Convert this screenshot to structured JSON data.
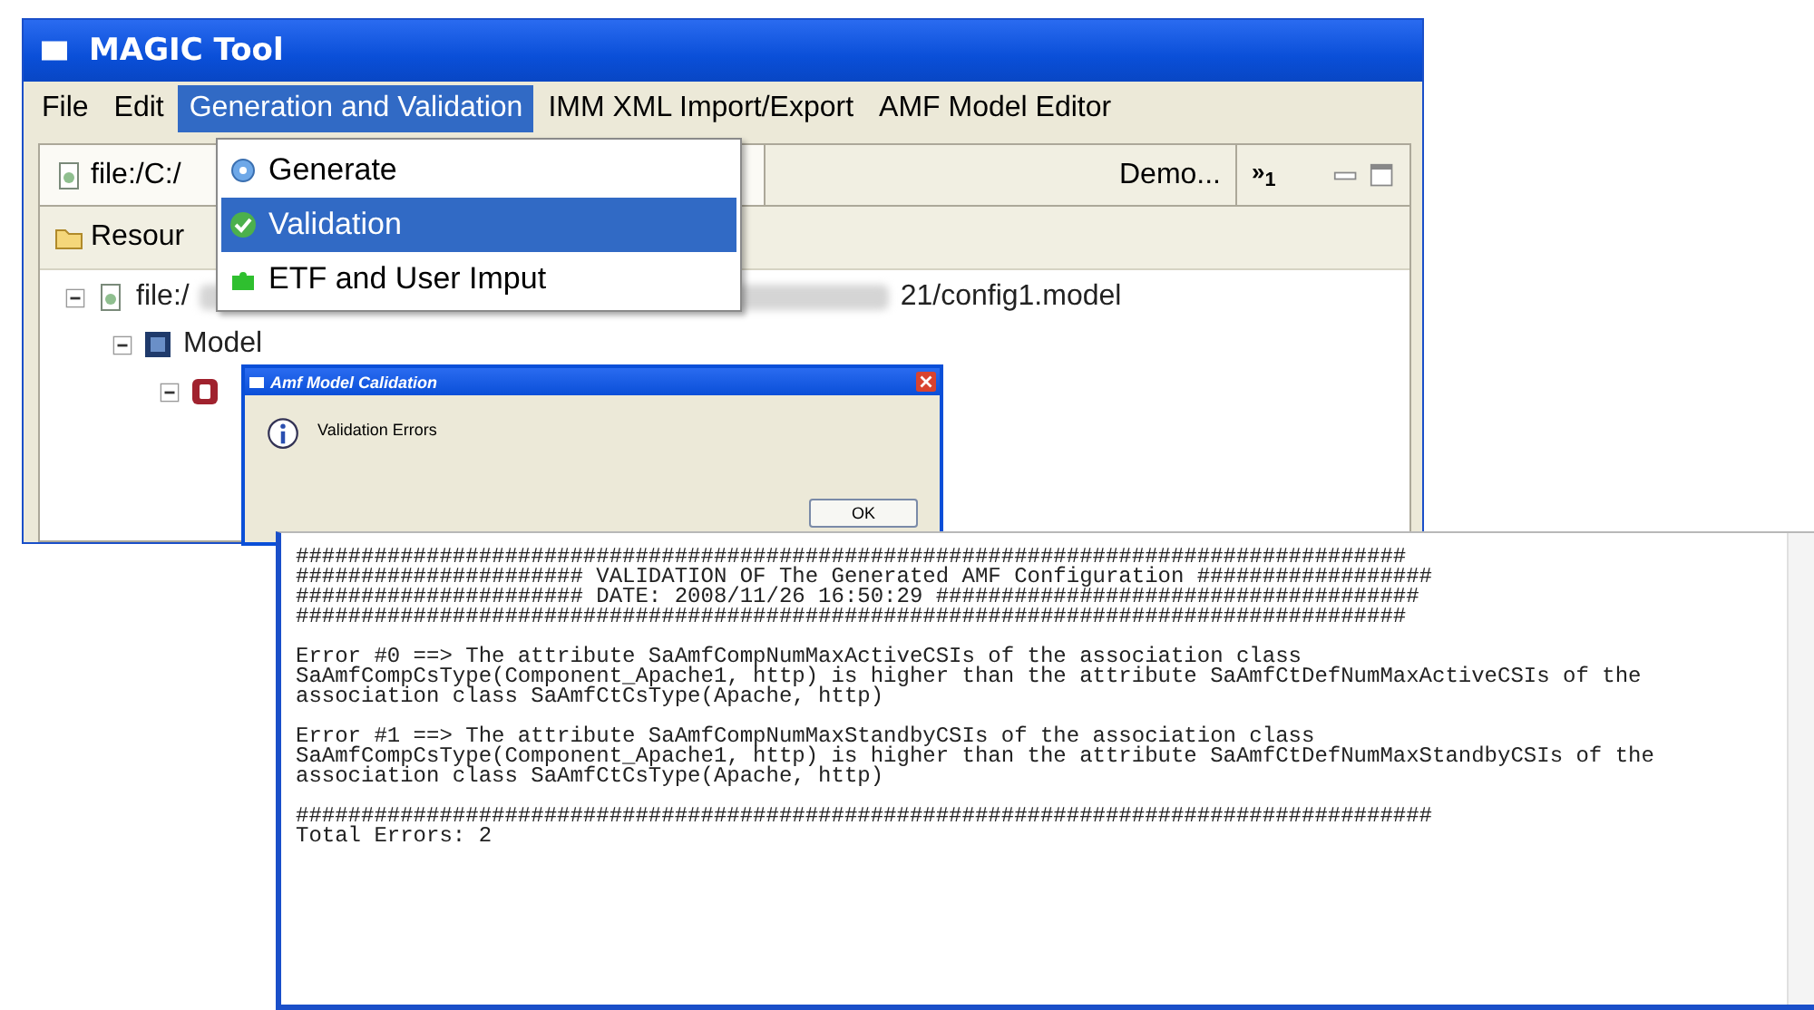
{
  "main_window": {
    "title": "MAGIC Tool"
  },
  "menu_bar": [
    {
      "label": "File",
      "selected": false
    },
    {
      "label": "Edit",
      "selected": false
    },
    {
      "label": "Generation and Validation",
      "selected": true
    },
    {
      "label": "IMM XML Import/Export",
      "selected": false
    },
    {
      "label": "AMF Model Editor",
      "selected": false
    }
  ],
  "dropdown_menu": [
    {
      "label": "Generate",
      "selected": false
    },
    {
      "label": "Validation",
      "selected": true
    },
    {
      "label": "ETF and User Imput",
      "selected": false
    }
  ],
  "editor_tabs": [
    {
      "label": "file:/C:/",
      "selected": true
    },
    {
      "label": "Demo...",
      "selected": false
    }
  ],
  "tab_overflow": "»$_{1}$",
  "resources_tab": {
    "label": "Resour"
  },
  "tree": [
    {
      "label_start": "file:/",
      "label_end": "21/config1.model",
      "expanded": true,
      "children": [
        {
          "label": "Model",
          "expanded": true,
          "children": [
            {
              "expanded": true
            }
          ]
        }
      ]
    }
  ],
  "dialog": {
    "title": "Amf Model Calidation",
    "message": "Validation Errors",
    "button": "OK"
  },
  "console": {
    "blocks": [
      [
        "#####################################################################################",
        "###################### VALIDATION OF The Generated AMF Configuration ##################",
        "###################### DATE: 2008/11/26 16:50:29 #####################################",
        "#####################################################################################"
      ],
      [
        "Error #0 ==> The attribute SaAmfCompNumMaxActiveCSIs of the association class",
        "SaAmfCompCsType(Component_Apache1, http) is higher than the attribute SaAmfCtDefNumMaxActiveCSIs of the",
        "association class SaAmfCtCsType(Apache, http)"
      ],
      [
        "Error #1 ==> The attribute SaAmfCompNumMaxStandbyCSIs of the association class",
        "SaAmfCompCsType(Component_Apache1, http) is higher than the attribute SaAmfCtDefNumMaxStandbyCSIs of the",
        "association class SaAmfCtCsType(Apache, http)"
      ],
      [
        "#######################################################################################",
        "Total Errors: 2"
      ]
    ]
  }
}
